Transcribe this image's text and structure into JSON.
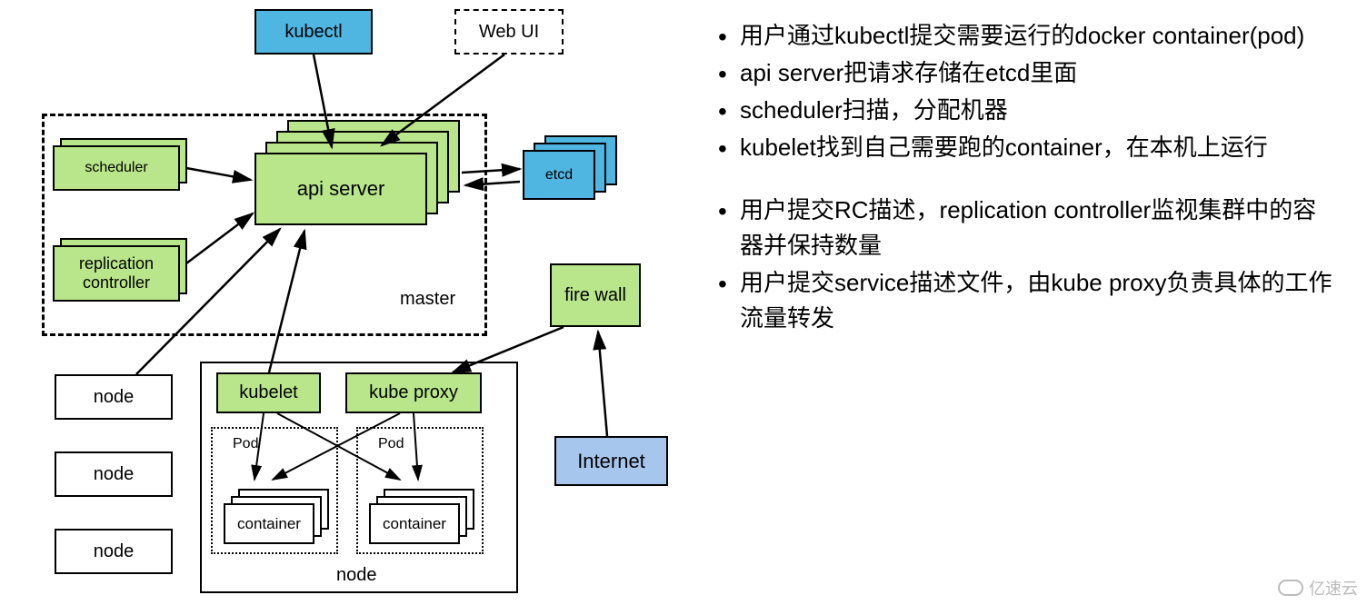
{
  "top": {
    "kubectl": "kubectl",
    "webui": "Web UI"
  },
  "master": {
    "label": "master",
    "scheduler": "scheduler",
    "replication": "replication\ncontroller",
    "apiserver": "api server",
    "etcd": "etcd"
  },
  "nodeBoxes": {
    "n1": "node",
    "n2": "node",
    "n3": "node"
  },
  "nodeDetail": {
    "label": "node",
    "kubelet": "kubelet",
    "kubeproxy": "kube proxy",
    "pod1": "Pod",
    "pod2": "Pod",
    "container1": "container",
    "container2": "container"
  },
  "external": {
    "firewall": "fire wall",
    "internet": "Internet"
  },
  "bullets": {
    "group1": [
      "用户通过kubectl提交需要运行的docker container(pod)",
      "api server把请求存储在etcd里面",
      "scheduler扫描，分配机器",
      "kubelet找到自己需要跑的container，在本机上运行"
    ],
    "group2": [
      "用户提交RC描述，replication controller监视集群中的容器并保持数量",
      "用户提交service描述文件，由kube proxy负责具体的工作流量转发"
    ]
  },
  "watermark": "亿速云"
}
